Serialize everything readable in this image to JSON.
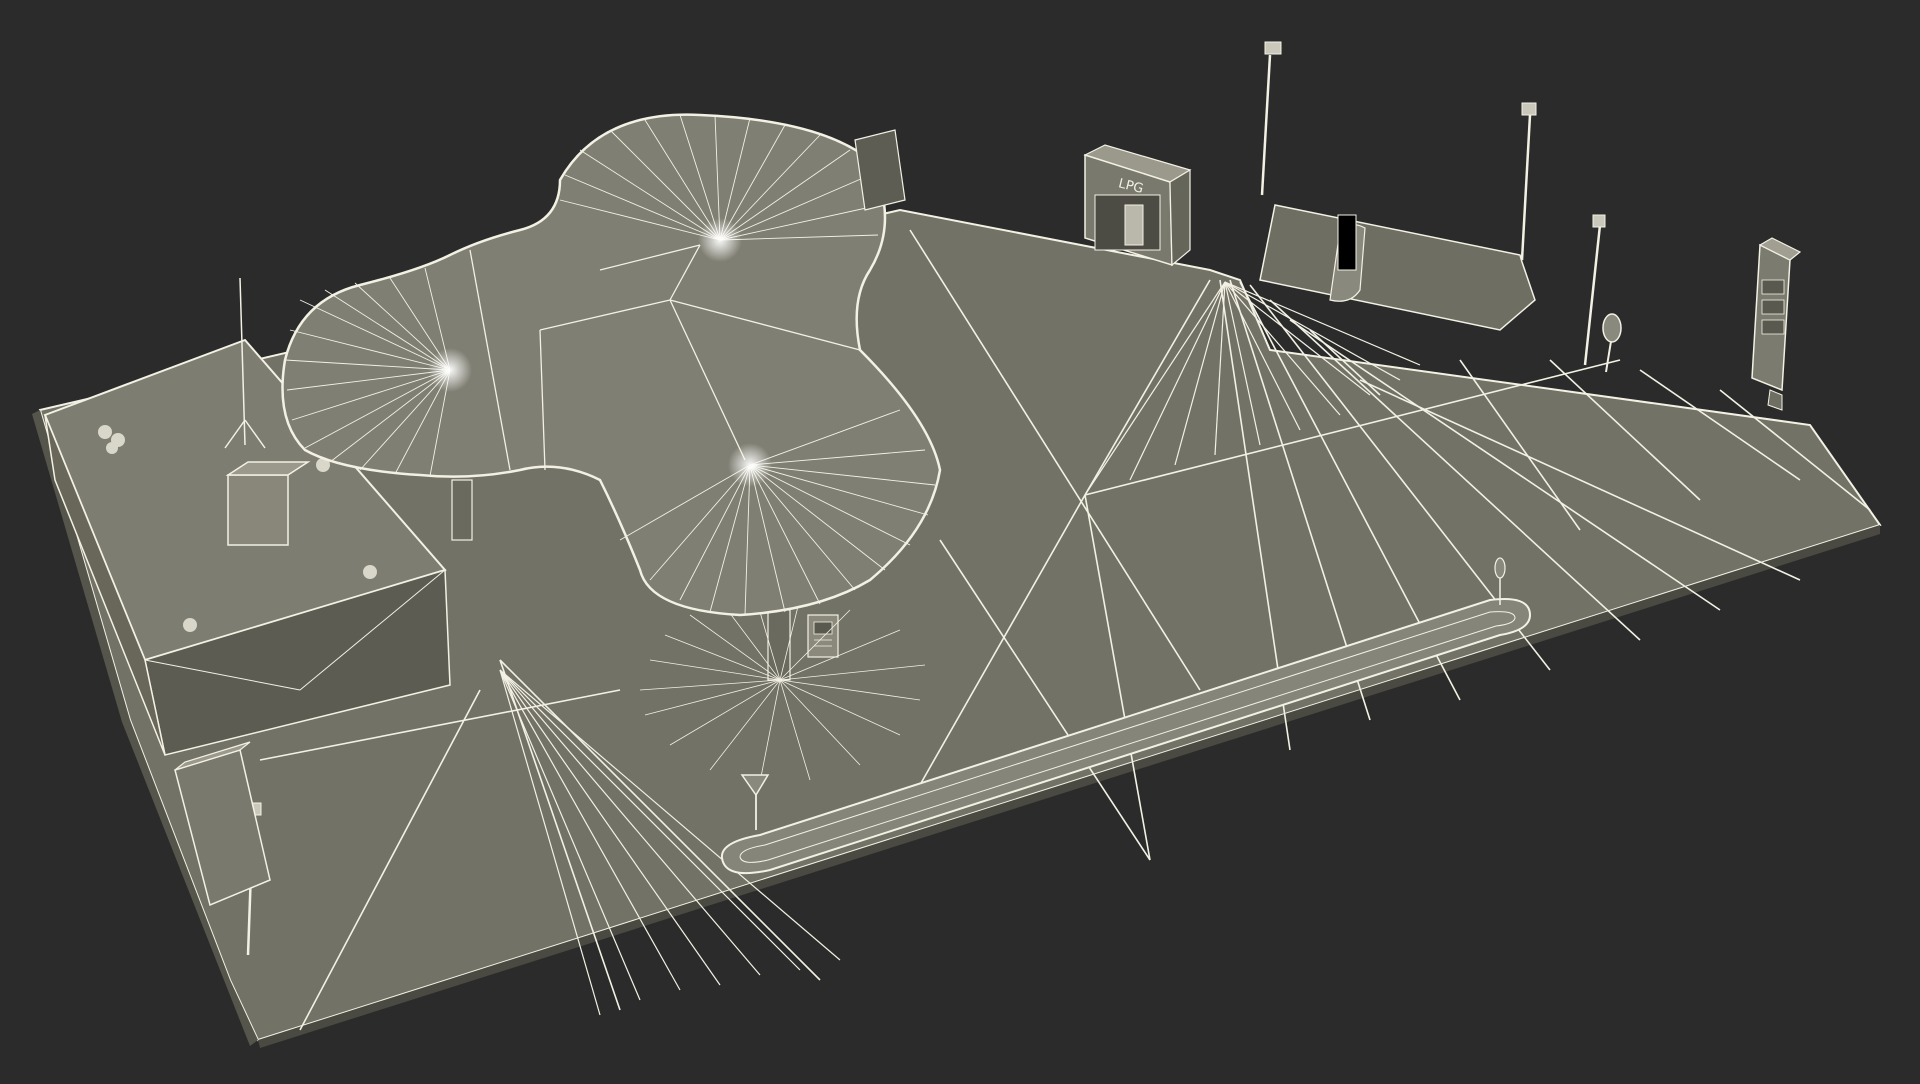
{
  "scene": {
    "subject": "gas-station-wireframe",
    "background_color": "#2b2b2b",
    "surface_color": "#7c7b6e",
    "surface_dark": "#5f5e54",
    "wire_color": "#f2f1e4",
    "highlight_color": "#ffffff"
  },
  "signage": {
    "lpg_label": "LPG"
  }
}
